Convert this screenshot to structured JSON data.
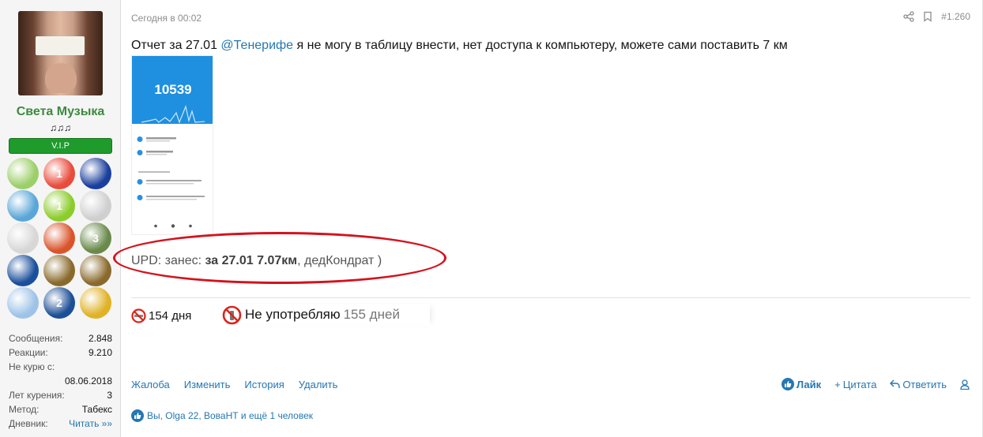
{
  "user": {
    "name": "Света Музыка",
    "notes": "♫♫♫",
    "badge": "V.I.P",
    "stats": [
      {
        "label": "Сообщения:",
        "value": "2.848"
      },
      {
        "label": "Реакции:",
        "value": "9.210"
      },
      {
        "label": "Не курю с:",
        "value": ""
      },
      {
        "label": "",
        "value": "08.06.2018"
      },
      {
        "label": "Лет курения:",
        "value": "3"
      },
      {
        "label": "Метод:",
        "value": "Табекс"
      },
      {
        "label": "Дневник:",
        "value": "Читать »»"
      }
    ],
    "awards": [
      {
        "icon": "flower-award-icon",
        "color": "#9ccf6a"
      },
      {
        "icon": "cup-1-award-icon",
        "color": "#e94b3c",
        "label": "1"
      },
      {
        "icon": "trophy-award-icon",
        "color": "#1a3f9c"
      },
      {
        "icon": "new-year-award-icon",
        "color": "#5aa6d8"
      },
      {
        "icon": "apple-award-icon",
        "color": "#8ccc2b",
        "label": "1"
      },
      {
        "icon": "key-award-icon",
        "color": "#cfcfcf"
      },
      {
        "icon": "key-duck-award-icon",
        "color": "#d7d7d7"
      },
      {
        "icon": "camera-award-icon",
        "color": "#d9542b"
      },
      {
        "icon": "ball-3-award-icon",
        "color": "#6a8a4b",
        "label": "3"
      },
      {
        "icon": "megaphone-award-icon",
        "color": "#1b4f9c"
      },
      {
        "icon": "bronze-medal-icon",
        "color": "#8a6a2c"
      },
      {
        "icon": "bronze-medal-icon",
        "color": "#8a6a2c"
      },
      {
        "icon": "angel-award-icon",
        "color": "#9ec3e8"
      },
      {
        "icon": "group-2-award-icon",
        "color": "#1d4f97",
        "label": "2"
      },
      {
        "icon": "medal-red-award-icon",
        "color": "#e0b226"
      }
    ]
  },
  "post": {
    "date": "Сегодня в 00:02",
    "number": "#1.260",
    "text_before": "Отчет за 27.01 ",
    "mention": "@Тенерифе",
    "text_after": " я не могу в таблицу внести, нет доступа к компьютеру, можете сами поставить 7 км",
    "screenshot_steps": "10539",
    "upd_prefix": "UPD: занес: ",
    "upd_bold": "за 27.01 7.07км",
    "upd_suffix": ", дедКондрат )"
  },
  "signature": {
    "days1": "154 дня",
    "status": "Не употребляю",
    "days2": "155 дней"
  },
  "actions": {
    "report": "Жалоба",
    "edit": "Изменить",
    "history": "История",
    "delete": "Удалить",
    "like": "Лайк",
    "quote": "Цитата",
    "reply": "Ответить"
  },
  "reactions": {
    "text": "Вы, Olga 22, ВоваНТ и ещё 1 человек"
  },
  "colors": {
    "accent": "#2577b1",
    "username": "#3c8a3f",
    "vip": "#1e9b2b",
    "highlight_ellipse": "#d4121c"
  }
}
